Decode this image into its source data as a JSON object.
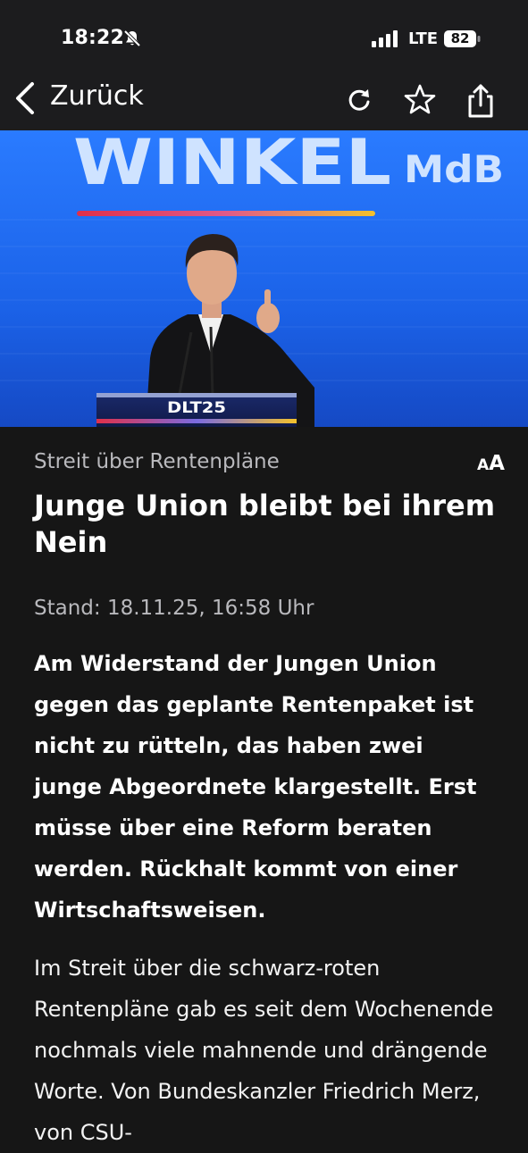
{
  "status_bar": {
    "time": "18:22",
    "network": "LTE",
    "battery": "82",
    "icons": [
      "bell-muted-icon",
      "signal-icon",
      "battery-icon"
    ]
  },
  "nav": {
    "back_label": "Zurück",
    "icons": [
      "chevron-left-icon",
      "reload-icon",
      "star-icon",
      "share-icon"
    ]
  },
  "hero": {
    "backdrop_title": "WINKEL",
    "backdrop_suffix": "MdB",
    "podium_label": "DLT25"
  },
  "article": {
    "kicker": "Streit über Rentenpläne",
    "text_size_small": "A",
    "text_size_big": "A",
    "headline": "Junge Union bleibt bei ihrem Nein",
    "dateline": "Stand: 18.11.25, 16:58 Uhr",
    "teaser": "Am Widerstand der Jungen Union gegen das geplante Rentenpaket ist nicht zu rütteln, das haben zwei junge Abgeordnete klargestellt. Erst müsse über eine Reform beraten werden. Rückhalt kommt von einer Wirtschaftsweisen.",
    "body": "Im Streit über die schwarz-roten Rentenpläne gab es seit dem Wochenende nochmals viele mahnende und drängende Worte. Von Bundeskanzler Friedrich Merz, von CSU-"
  },
  "colors": {
    "background": "#161616",
    "bar": "#1c1c1e",
    "muted_text": "#b9b9bd",
    "hero_blue": "#1f6ff5"
  }
}
